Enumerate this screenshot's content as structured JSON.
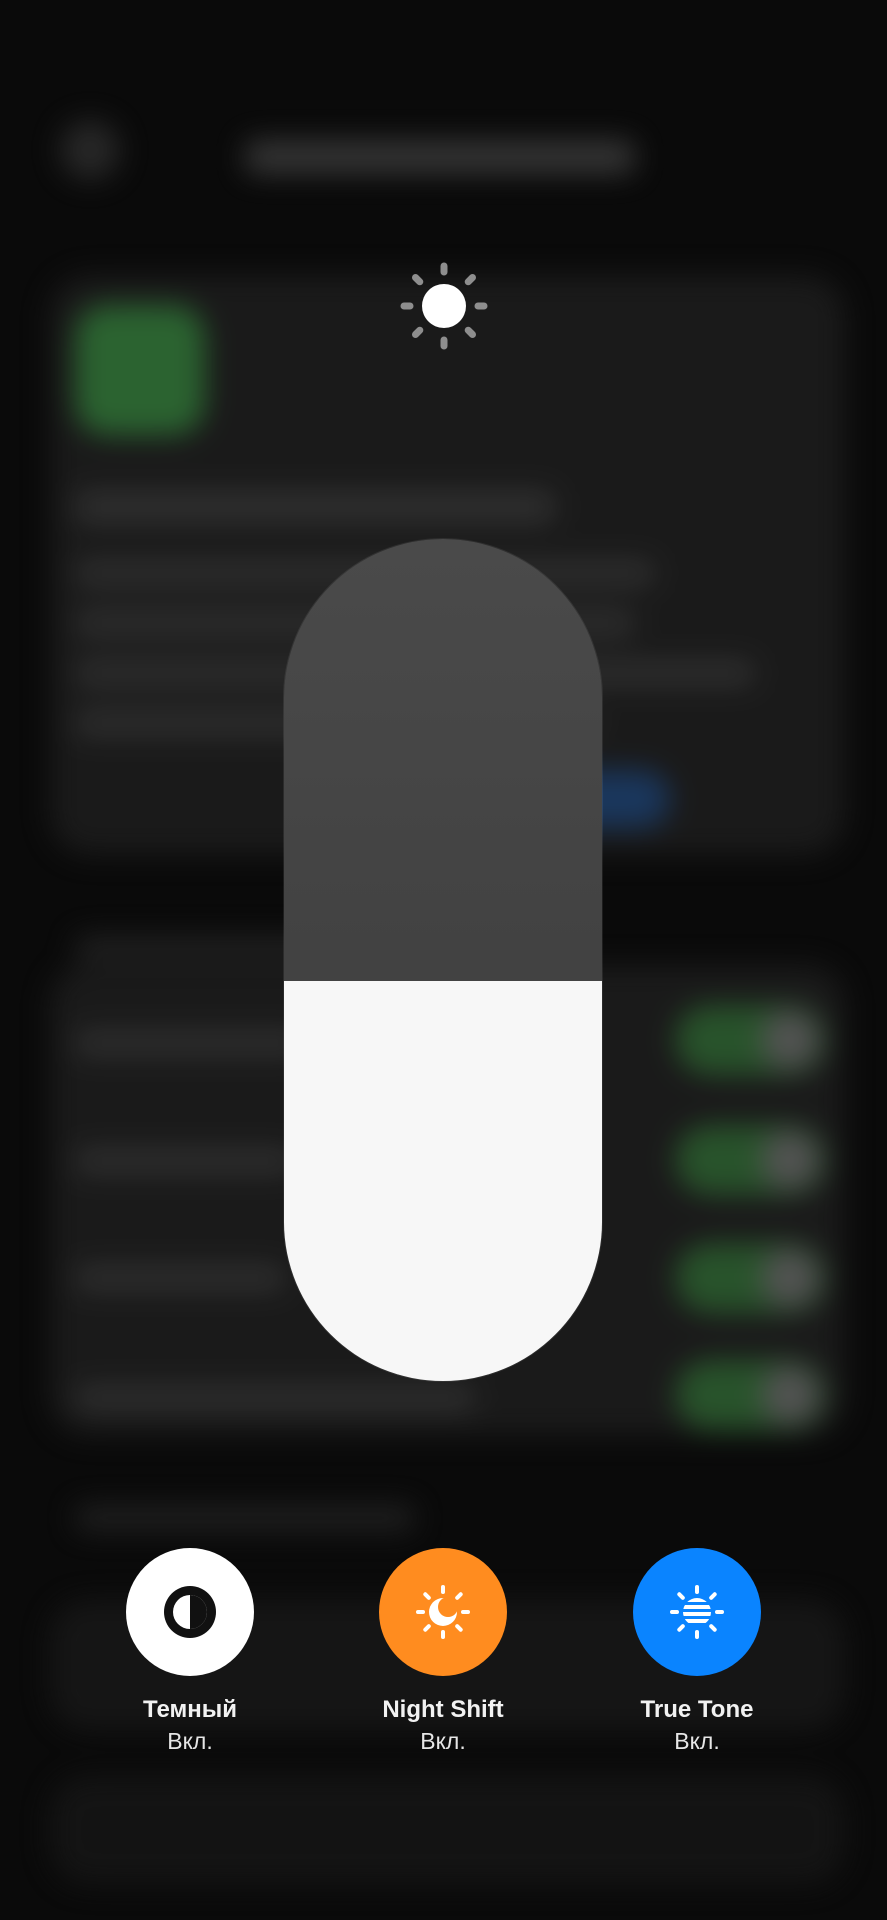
{
  "brightness": {
    "level": 0.475,
    "icon": "sun-icon"
  },
  "controls": [
    {
      "id": "dark-mode",
      "label": "Темный",
      "status": "Вкл.",
      "color": "#ffffff",
      "icon": "dark-mode-icon"
    },
    {
      "id": "night-shift",
      "label": "Night Shift",
      "status": "Вкл.",
      "color": "#ff8c1f",
      "icon": "night-shift-icon"
    },
    {
      "id": "true-tone",
      "label": "True Tone",
      "status": "Вкл.",
      "color": "#0a84ff",
      "icon": "true-tone-icon"
    }
  ]
}
